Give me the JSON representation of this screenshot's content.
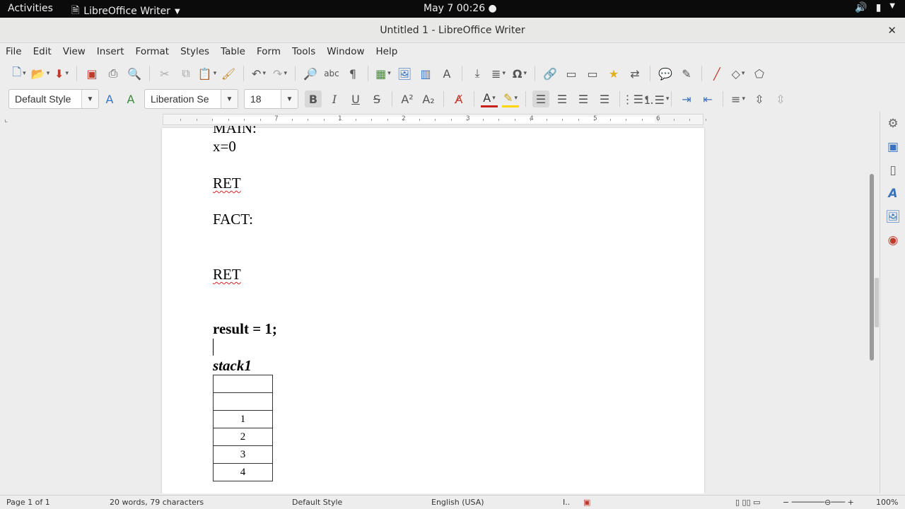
{
  "system": {
    "activities": "Activities",
    "app_name": "LibreOffice Writer",
    "clock": "May 7  00:26"
  },
  "window": {
    "title": "Untitled 1 - LibreOffice Writer"
  },
  "menu": [
    "File",
    "Edit",
    "View",
    "Insert",
    "Format",
    "Styles",
    "Table",
    "Form",
    "Tools",
    "Window",
    "Help"
  ],
  "formatting": {
    "paragraph_style": "Default Style",
    "font_name": "Liberation Se",
    "font_size": "18"
  },
  "ruler": {
    "numbers": [
      "1",
      "2",
      "3",
      "4",
      "5",
      "6",
      "7"
    ]
  },
  "document": {
    "clipped_heading": "MAIN:",
    "line_x": "x=0",
    "ret1": "RET",
    "fact": "FACT:",
    "ret2": "RET",
    "result": "result = 1;",
    "stack_label": "stack1",
    "stack_cells": [
      "",
      "",
      "1",
      "2",
      "3",
      "4"
    ]
  },
  "status": {
    "page": "Page 1 of 1",
    "counts": "20 words, 79 characters",
    "style": "Default Style",
    "language": "English (USA)",
    "zoom": "100%"
  },
  "colors": {
    "font_color": "#c9211e",
    "highlight": "#ffd600",
    "topbar": "#0b0b0b"
  }
}
